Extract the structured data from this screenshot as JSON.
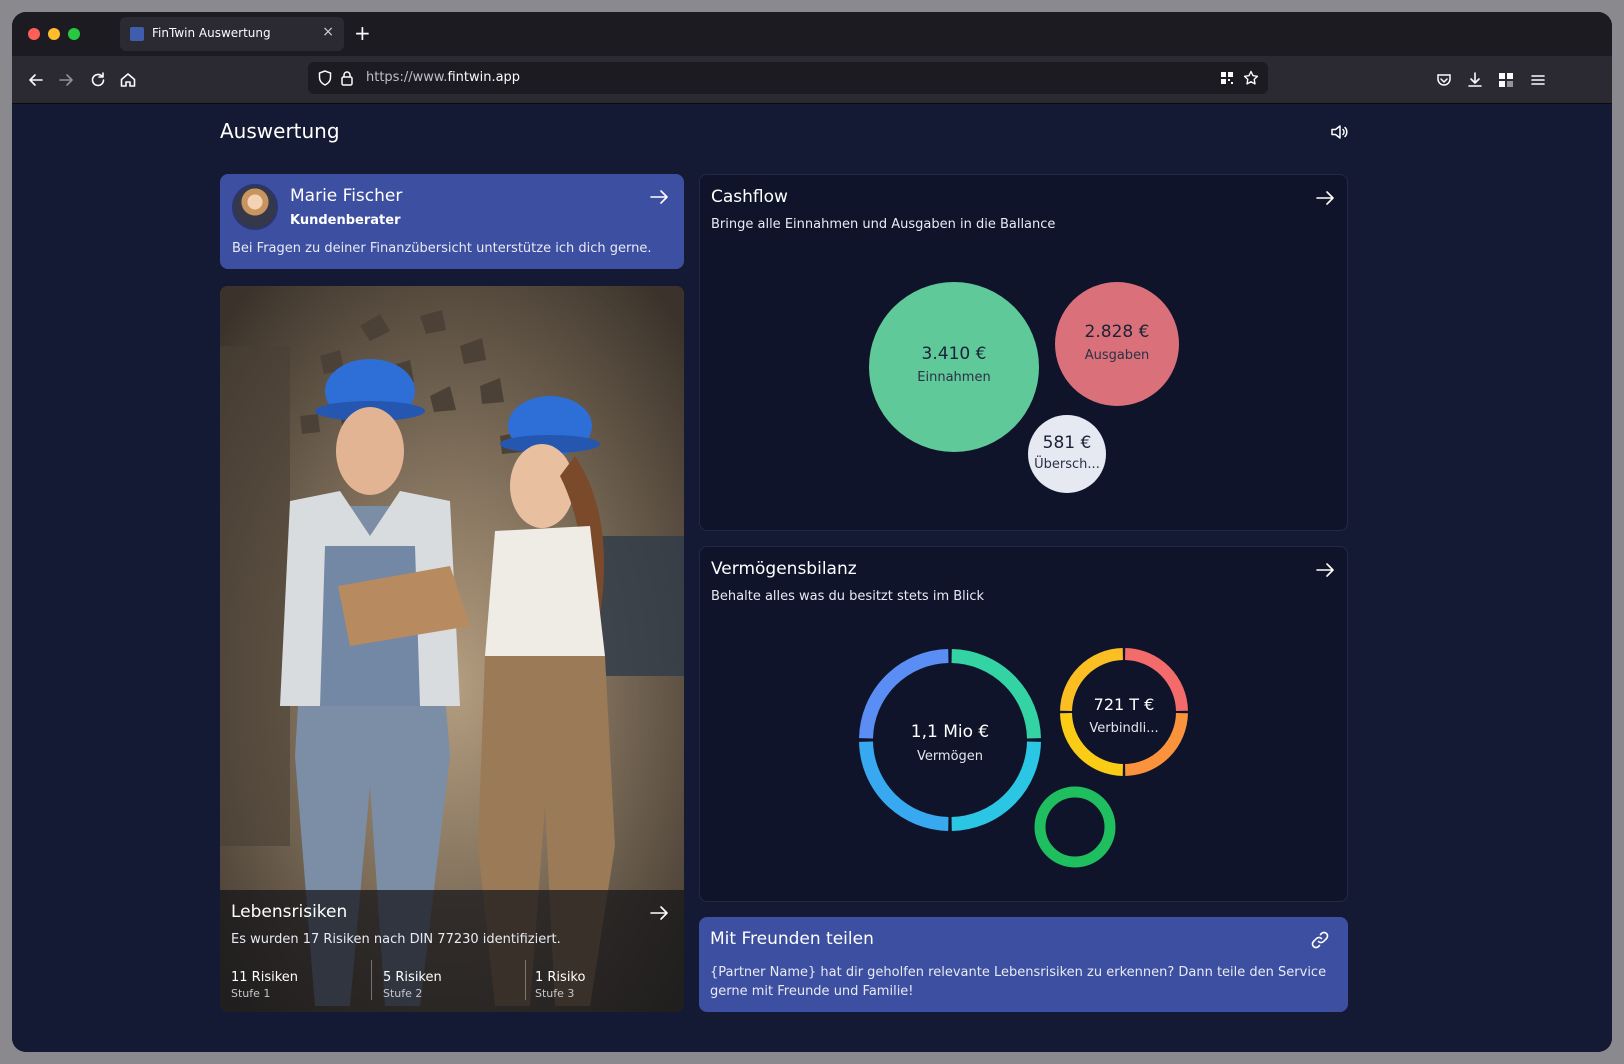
{
  "browser": {
    "tab_title": "FinTwin Auswertung",
    "tab_close": "×",
    "newtab": "+",
    "url_prefix": "https://www.",
    "url_domain": "fintwin.app"
  },
  "page": {
    "title": "Auswertung"
  },
  "advisor": {
    "name": "Marie Fischer",
    "role": "Kundenberater",
    "message": "Bei Fragen zu deiner Finanzübersicht unterstütze ich dich gerne."
  },
  "risks": {
    "title": "Lebensrisiken",
    "description": "Es wurden 17 Risiken nach DIN 77230 identifiziert.",
    "stats": [
      {
        "count": "11 Risiken",
        "level": "Stufe 1"
      },
      {
        "count": "5 Risiken",
        "level": "Stufe 2"
      },
      {
        "count": "1 Risiko",
        "level": "Stufe 3"
      }
    ]
  },
  "cashflow": {
    "title": "Cashflow",
    "subtitle": "Bringe alle Einnahmen und Ausgaben in die Ballance",
    "income": {
      "value": "3.410 €",
      "label": "Einnahmen",
      "color": "#5fc999"
    },
    "expenses": {
      "value": "2.828 €",
      "label": "Ausgaben",
      "color": "#d9707a"
    },
    "surplus": {
      "value": "581 €",
      "label": "Übersch...",
      "color": "#e6e8f2"
    }
  },
  "assets": {
    "title": "Vermögensbilanz",
    "subtitle": "Behalte alles was du besitzt stets im Blick",
    "wealth": {
      "value": "1,1 Mio €",
      "label": "Vermögen"
    },
    "liabilities": {
      "value": "721 T €",
      "label": "Verbindli..."
    },
    "ring_colors": {
      "wealth": [
        "#34d3a4",
        "#2bc6e4",
        "#38a8f0",
        "#5b8ef5"
      ],
      "liabilities": [
        "#f46b6b",
        "#fb923c",
        "#facc15",
        "#fbbf24"
      ],
      "third": "#1fbf5f"
    }
  },
  "share": {
    "title": "Mit Freunden teilen",
    "message": "{Partner Name} hat dir geholfen relevante Lebensrisiken zu erkennen? Dann teile den Service gerne mit Freunde und Familie!"
  },
  "icons": [
    "back-icon",
    "forward-icon",
    "reload-icon",
    "home-icon",
    "shield-icon",
    "lock-icon",
    "qr-icon",
    "star-icon",
    "pocket-icon",
    "download-icon",
    "extensions-icon",
    "menu-icon",
    "speaker-icon",
    "arrow-right-icon",
    "link-icon"
  ]
}
